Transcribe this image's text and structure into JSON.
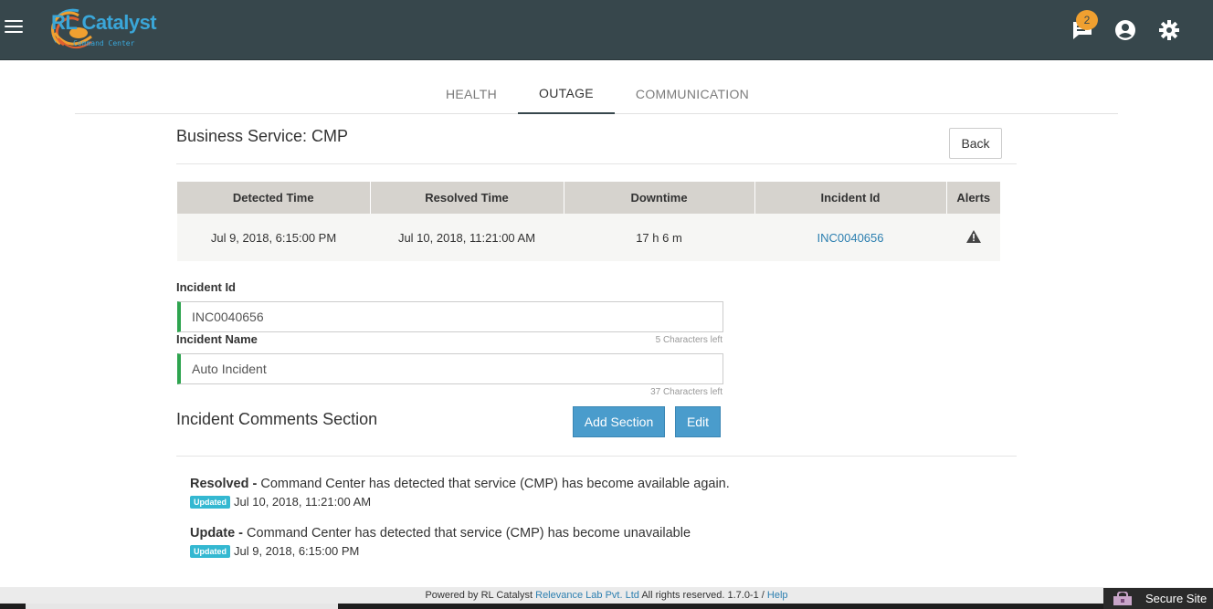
{
  "header": {
    "logo_text": "RL Catalyst",
    "logo_subtext": "Command Center",
    "notification_count": "2",
    "icons": [
      "menu-icon",
      "chat-notification-icon",
      "account-icon",
      "gear-icon"
    ]
  },
  "tabs": [
    {
      "label": "HEALTH",
      "active": false
    },
    {
      "label": "OUTAGE",
      "active": true
    },
    {
      "label": "COMMUNICATION",
      "active": false
    }
  ],
  "page": {
    "title": "Business Service: CMP",
    "back_label": "Back"
  },
  "table": {
    "columns": [
      "Detected Time",
      "Resolved Time",
      "Downtime",
      "Incident Id",
      "Alerts"
    ],
    "rows": [
      {
        "detected": "Jul 9, 2018, 6:15:00 PM",
        "resolved": "Jul 10, 2018, 11:21:00 AM",
        "downtime": "17 h 6 m",
        "incident_id": "INC0040656",
        "alert_icon": "warning-icon"
      }
    ]
  },
  "form": {
    "incident_id_label": "Incident Id",
    "incident_id_value": "INC0040656",
    "incident_id_chars": "5 Characters left",
    "incident_name_label": "Incident Name",
    "incident_name_value": "Auto Incident",
    "incident_name_chars": "37 Characters left"
  },
  "comments_section": {
    "title": "Incident Comments Section",
    "add_label": "Add Section",
    "edit_label": "Edit",
    "items": [
      {
        "kind": "Resolved -",
        "text": " Command Center has detected that service (CMP) has become available again.",
        "badge": "Updated",
        "timestamp": "Jul 10, 2018, 11:21:00 AM"
      },
      {
        "kind": "Update -",
        "text": " Command Center has detected that service (CMP) has become unavailable",
        "badge": "Updated",
        "timestamp": "Jul 9, 2018, 6:15:00 PM"
      }
    ]
  },
  "footer": {
    "powered": "Powered by RL Catalyst ",
    "company": "Relevance Lab Pvt. Ltd",
    "rights": " All rights reserved. 1.7.0-1 / ",
    "help": "Help",
    "secure_label": "Secure Site"
  },
  "colors": {
    "topbar": "#37474c",
    "accent_orange": "#f0a030",
    "link_blue": "#2c7fb0",
    "button_blue": "#4a9ccc",
    "valid_green": "#2ea44f",
    "badge_cyan": "#34b8d1"
  }
}
